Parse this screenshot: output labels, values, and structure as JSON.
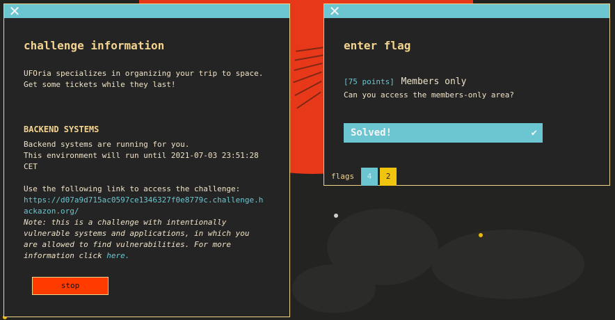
{
  "colors": {
    "accent_cyan": "#6cc6d1",
    "title_yellow": "#f4d48f",
    "stop_red": "#ff3b00",
    "background": "#232322",
    "blob_red": "#e8381a"
  },
  "info_panel": {
    "close_icon": "close-icon",
    "title": "challenge information",
    "description_line1": "UFOria specializes in organizing your trip to space.",
    "description_line2": "Get some tickets while they last!",
    "backend_heading": "BACKEND SYSTEMS",
    "backend_line1": "Backend systems are running for you.",
    "backend_line2": "This environment will run until 2021-07-03 23:51:28",
    "backend_line3": "CET",
    "link_intro": "Use the following link to access the challenge:",
    "link_line1": "https://d07a9d715ac0597ce1346327f0e8779c.challenge.h",
    "link_line2": "ackazon.org/",
    "note_line1": "Note: this is a challenge with intentionally",
    "note_line2": "vulnerable systems and applications, in which you",
    "note_line3": "are allowed to find vulnerabilities. For more",
    "note_line4_prefix": "information click ",
    "note_link": "here.",
    "stop_label": "stop"
  },
  "flag_panel": {
    "close_icon": "close-icon",
    "title": "enter flag",
    "points": "[75 points]",
    "challenge_name": "Members only",
    "question": "Can you access the members-only area?",
    "solved_label": "Solved!",
    "check_icon": "check-icon",
    "flags_label": "flags",
    "flag_tabs": [
      {
        "label": "4",
        "color": "#6cc6d1",
        "text_color": "#c9ecf0"
      },
      {
        "label": "2",
        "color": "#f1c40f",
        "text_color": "#222222"
      }
    ]
  }
}
